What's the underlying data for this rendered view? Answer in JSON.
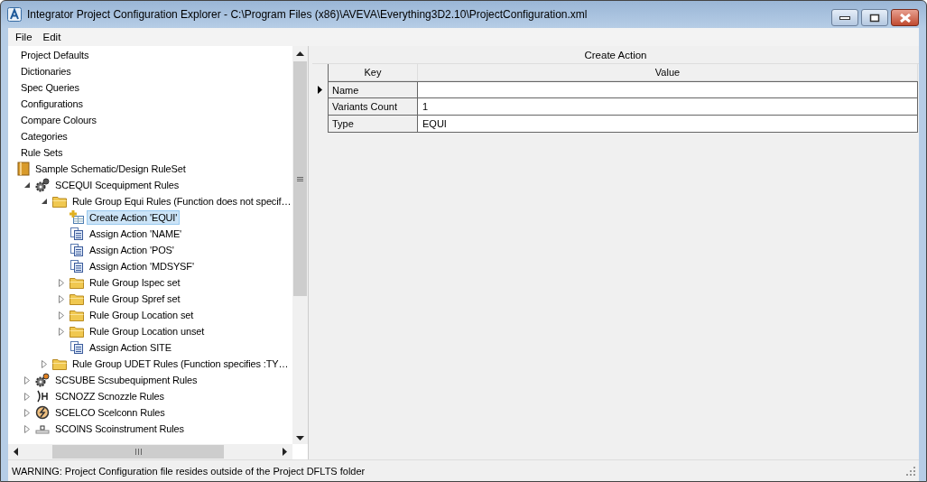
{
  "window": {
    "title": "Integrator Project Configuration Explorer - C:\\Program Files (x86)\\AVEVA\\Everything3D2.10\\ProjectConfiguration.xml"
  },
  "menu": [
    "File",
    "Edit"
  ],
  "tree": [
    {
      "label": "Project Defaults",
      "selected": false
    },
    {
      "label": "Dictionaries",
      "selected": false
    },
    {
      "label": "Spec Queries",
      "selected": false
    },
    {
      "label": "Configurations",
      "selected": false
    },
    {
      "label": "Compare Colours",
      "selected": false
    },
    {
      "label": "Categories",
      "selected": false
    },
    {
      "label": "Rule Sets",
      "selected": false
    },
    {
      "label": "Sample Schematic/Design RuleSet",
      "kind": "book",
      "selected": false,
      "children": [
        {
          "label": "SCEQUI Scequipment Rules",
          "kind": "gear",
          "expanded": true,
          "selected": false,
          "children": [
            {
              "label": "Rule Group Equi Rules (Function does not specif…",
              "kind": "folder",
              "expanded": true,
              "selected": false,
              "children": [
                {
                  "label": "Create Action 'EQUI'",
                  "kind": "create",
                  "selected": true
                },
                {
                  "label": "Assign Action 'NAME'",
                  "kind": "assign",
                  "selected": false
                },
                {
                  "label": "Assign Action 'POS'",
                  "kind": "assign",
                  "selected": false
                },
                {
                  "label": "Assign Action 'MDSYSF'",
                  "kind": "assign",
                  "selected": false
                },
                {
                  "label": "Rule Group Ispec set",
                  "kind": "folder",
                  "expanded": false,
                  "selected": false
                },
                {
                  "label": "Rule Group Spref set",
                  "kind": "folder",
                  "expanded": false,
                  "selected": false
                },
                {
                  "label": "Rule Group Location set",
                  "kind": "folder",
                  "expanded": false,
                  "selected": false
                },
                {
                  "label": "Rule Group Location unset",
                  "kind": "folder",
                  "expanded": false,
                  "selected": false
                },
                {
                  "label": "Assign Action SITE",
                  "kind": "assign",
                  "selected": false
                }
              ]
            },
            {
              "label": "Rule Group UDET Rules (Function specifies :TY…",
              "kind": "folder",
              "expanded": false,
              "selected": false
            }
          ]
        },
        {
          "label": "SCSUBE Scsubequipment Rules",
          "kind": "gear",
          "expanded": false,
          "selected": false
        },
        {
          "label": "SCNOZZ Scnozzle Rules",
          "kind": "nozzle",
          "expanded": false,
          "selected": false
        },
        {
          "label": "SCELCO Scelconn Rules",
          "kind": "elconn",
          "expanded": false,
          "selected": false
        },
        {
          "label": "SCOINS Scoinstrument Rules",
          "kind": "instrument",
          "expanded": false,
          "selected": false
        }
      ]
    }
  ],
  "grid": {
    "title": "Create Action",
    "columns": [
      "Key",
      "Value"
    ],
    "rows": [
      {
        "key": "Name",
        "value": "",
        "current": true
      },
      {
        "key": "Variants Count",
        "value": "1",
        "current": false
      },
      {
        "key": "Type",
        "value": "EQUI",
        "current": false
      }
    ]
  },
  "status_bar": "WARNING: Project Configuration file resides outside of the Project DFLTS folder"
}
